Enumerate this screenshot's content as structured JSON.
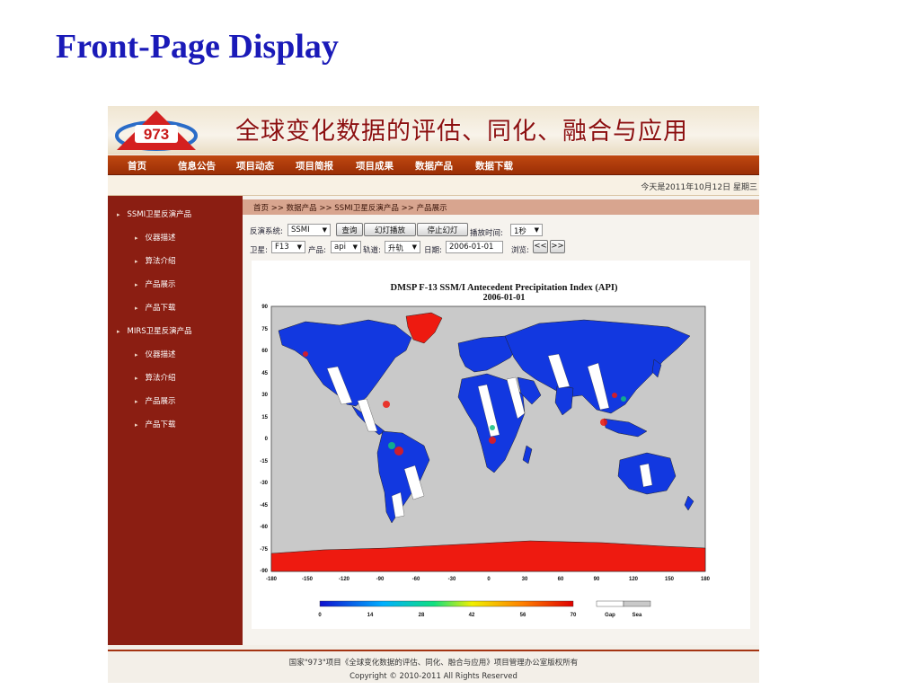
{
  "slide": {
    "title": "Front-Page Display"
  },
  "site": {
    "logo_text": "973",
    "banner_title": "全球变化数据的评估、同化、融合与应用",
    "menu": [
      "首页",
      "信息公告",
      "项目动态",
      "项目简报",
      "项目成果",
      "数据产品",
      "数据下载"
    ],
    "date": "今天是2011年10月12日 星期三",
    "sidebar": [
      {
        "label": "SSMI卫星反演产品",
        "level": 0
      },
      {
        "label": "仪器描述",
        "level": 1
      },
      {
        "label": "算法介绍",
        "level": 1
      },
      {
        "label": "产品展示",
        "level": 1
      },
      {
        "label": "产品下载",
        "level": 1
      },
      {
        "label": "MIRS卫星反演产品",
        "level": 0
      },
      {
        "label": "仪器描述",
        "level": 1
      },
      {
        "label": "算法介绍",
        "level": 1
      },
      {
        "label": "产品展示",
        "level": 1
      },
      {
        "label": "产品下载",
        "level": 1
      }
    ],
    "breadcrumb": "首页 >> 数据产品 >> SSMI卫星反演产品 >> 产品展示",
    "controls": {
      "system_label": "反演系统:",
      "system_value": "SSMI",
      "query_button": "查询",
      "slideshow_button": "幻灯播放",
      "stop_button": "停止幻灯",
      "interval_label": "播放时间:",
      "interval_value": "1秒",
      "satellite_label": "卫星:",
      "satellite_value": "F13",
      "product_label": "产品:",
      "product_value": "api",
      "orbit_label": "轨道:",
      "orbit_value": "升轨",
      "date_label": "日期:",
      "date_value": "2006-01-01",
      "browse_label": "浏览:",
      "prev_button": "<<",
      "next_button": ">>"
    },
    "map": {
      "title_line1": "DMSP F-13 SSM/I Antecedent Precipitation Index (API)",
      "title_line2": "2006-01-01",
      "lat_ticks": [
        "90",
        "75",
        "60",
        "45",
        "30",
        "15",
        "0",
        "-15",
        "-30",
        "-45",
        "-60",
        "-75",
        "-90"
      ],
      "lon_ticks": [
        "-180",
        "-150",
        "-120",
        "-90",
        "-60",
        "-30",
        "0",
        "30",
        "60",
        "90",
        "120",
        "150",
        "180"
      ],
      "colorbar_ticks": [
        "0",
        "14",
        "28",
        "42",
        "56",
        "70"
      ],
      "legend_gap": "Gap",
      "legend_sea": "Sea",
      "colors": {
        "ocean": "#c9c9c9",
        "land": "#1238e0",
        "gap": "#ffffff",
        "antarctica": "#ee1a10"
      }
    },
    "footer": {
      "line1": "国家\"973\"项目《全球变化数据的评估、同化、融合与应用》项目管理办公室版权所有",
      "line2": "Copyright © 2010-2011 All Rights Reserved"
    }
  }
}
